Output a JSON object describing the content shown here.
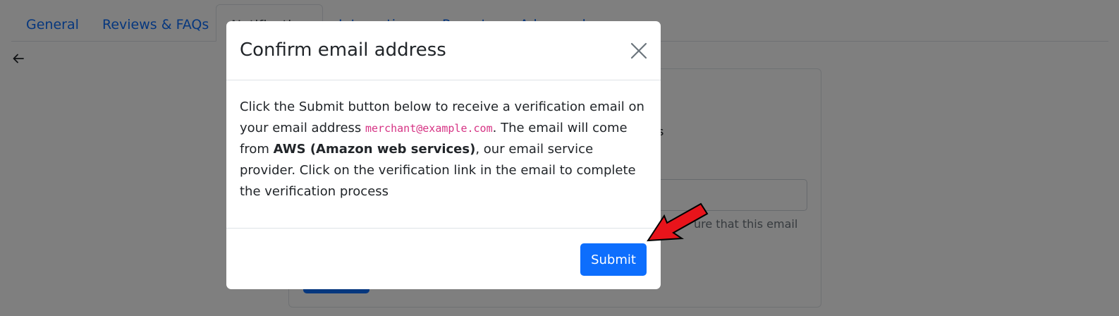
{
  "tabs": [
    "General",
    "Reviews & FAQs",
    "Notifications",
    "Integrations",
    "Reports",
    "Advanced"
  ],
  "background": {
    "back_icon": "arrow-left-icon",
    "help_text_fragment": "ure that this email",
    "partial_text": "s"
  },
  "modal": {
    "title": "Confirm email address",
    "close_icon": "close-icon",
    "body_part1": "Click the Submit button below to receive a verification email on your email address ",
    "email": "merchant@example.com",
    "body_part2": ". The email will come from ",
    "provider": "AWS (Amazon web services)",
    "body_part3": ", our email service provider. Click on the verification link in the email to complete the verification process",
    "submit_label": "Submit"
  },
  "annotation": {
    "arrow_icon": "red-arrow-icon",
    "arrow_color": "#e8141b"
  },
  "colors": {
    "primary": "#0d6efd",
    "code": "#d63384",
    "backdrop": "rgba(0,0,0,0.5)"
  }
}
